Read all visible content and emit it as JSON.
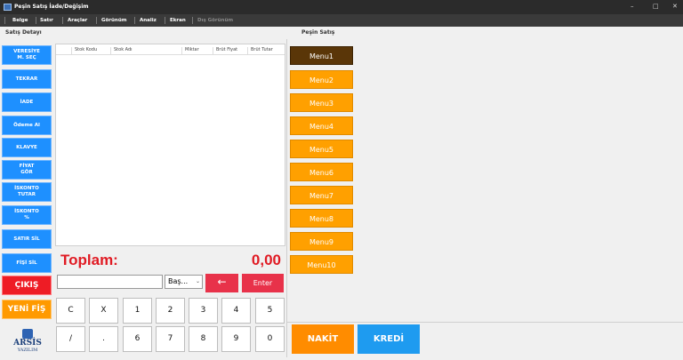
{
  "window": {
    "title": "Peşin Satış İade/Değişim",
    "controls": [
      "–",
      "□",
      "✕"
    ]
  },
  "menu": [
    "Belge",
    "Satır",
    "Araçlar",
    "Görünüm",
    "Analiz",
    "Ekran"
  ],
  "menu_disabled": "Dış Görünüm",
  "headers": {
    "left": "Satış Detayı",
    "right": "Peşin Satış"
  },
  "left_buttons": [
    {
      "label": "VERESİYE\nM. SEÇ",
      "color": "#1e90ff"
    },
    {
      "label": "TEKRAR",
      "color": "#1e90ff"
    },
    {
      "label": "İADE",
      "color": "#1e90ff"
    },
    {
      "label": "Ödeme Al",
      "color": "#1e90ff"
    },
    {
      "label": "KLAVYE",
      "color": "#1e90ff"
    },
    {
      "label": "FİYAT\nGÖR",
      "color": "#1e90ff"
    },
    {
      "label": "İSKONTO\nTUTAR",
      "color": "#1e90ff"
    },
    {
      "label": "İSKONTO\n%",
      "color": "#1e90ff"
    },
    {
      "label": "SATIR SİL",
      "color": "#1e90ff"
    },
    {
      "label": "FİŞİ SİL",
      "color": "#1e90ff"
    },
    {
      "label": "ÇIKIŞ",
      "color": "#ee1c25"
    },
    {
      "label": "YENİ FİŞ",
      "color": "#ff9a00"
    }
  ],
  "grid": {
    "columns": [
      "Stok Kodu",
      "Stok Adı",
      "Miktar",
      "Brüt Fiyat",
      "Brüt Tutar"
    ]
  },
  "total": {
    "label": "Toplam:",
    "value": "0,00"
  },
  "qty_input": {
    "value": ""
  },
  "unit_select": {
    "value": "Baş..."
  },
  "back_button": "←",
  "enter_button": "Enter",
  "keypad": [
    [
      "C",
      "X",
      "1",
      "2",
      "3",
      "4",
      "5"
    ],
    [
      "/",
      ".",
      "6",
      "7",
      "8",
      "9",
      "0"
    ]
  ],
  "menus": [
    "Menu1",
    "Menu2",
    "Menu3",
    "Menu4",
    "Menu5",
    "Menu6",
    "Menu7",
    "Menu8",
    "Menu9",
    "Menu10"
  ],
  "pay": {
    "cash": "NAKİT",
    "credit": "KREDİ"
  },
  "logo": {
    "brand": "ARSİS",
    "sub": "YAZILIM"
  }
}
